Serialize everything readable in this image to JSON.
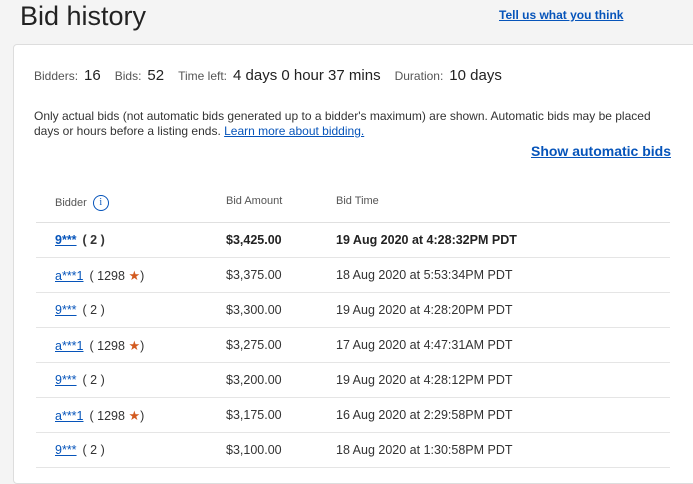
{
  "header": {
    "title": "Bid history",
    "feedback_link": "Tell us what you think"
  },
  "summary": {
    "bidders_label": "Bidders:",
    "bidders_value": "16",
    "bids_label": "Bids:",
    "bids_value": "52",
    "time_left_label": "Time left:",
    "time_left_value": "4 days 0 hour 37 mins",
    "duration_label": "Duration:",
    "duration_value": "10 days"
  },
  "notice": {
    "text": "Only actual bids (not automatic bids generated up to a bidder's maximum) are shown. Automatic bids may be placed days or hours before a listing ends. ",
    "link": "Learn more about bidding."
  },
  "show_automatic_bids": "Show automatic bids",
  "table": {
    "headers": {
      "bidder": "Bidder",
      "amount": "Bid Amount",
      "time": "Bid Time"
    },
    "info_icon": "i",
    "rows": [
      {
        "bidder": "9***",
        "feedback": "( 2 )",
        "star": false,
        "amount": "$3,425.00",
        "time": "19 Aug 2020 at 4:28:32PM PDT"
      },
      {
        "bidder": "a***1",
        "feedback": "( 1298",
        "star": true,
        "amount": "$3,375.00",
        "time": "18 Aug 2020 at 5:53:34PM PDT"
      },
      {
        "bidder": "9***",
        "feedback": "( 2 )",
        "star": false,
        "amount": "$3,300.00",
        "time": "19 Aug 2020 at 4:28:20PM PDT"
      },
      {
        "bidder": "a***1",
        "feedback": "( 1298",
        "star": true,
        "amount": "$3,275.00",
        "time": "17 Aug 2020 at 4:47:31AM PDT"
      },
      {
        "bidder": "9***",
        "feedback": "( 2 )",
        "star": false,
        "amount": "$3,200.00",
        "time": "19 Aug 2020 at 4:28:12PM PDT"
      },
      {
        "bidder": "a***1",
        "feedback": "( 1298",
        "star": true,
        "amount": "$3,175.00",
        "time": "16 Aug 2020 at 2:29:58PM PDT"
      },
      {
        "bidder": "9***",
        "feedback": "( 2 )",
        "star": false,
        "amount": "$3,100.00",
        "time": "18 Aug 2020 at 1:30:58PM PDT"
      }
    ]
  },
  "colors": {
    "link": "#0654ba",
    "star": "#d35a1f"
  },
  "icons": {
    "star": "star-icon",
    "info": "info-icon"
  }
}
